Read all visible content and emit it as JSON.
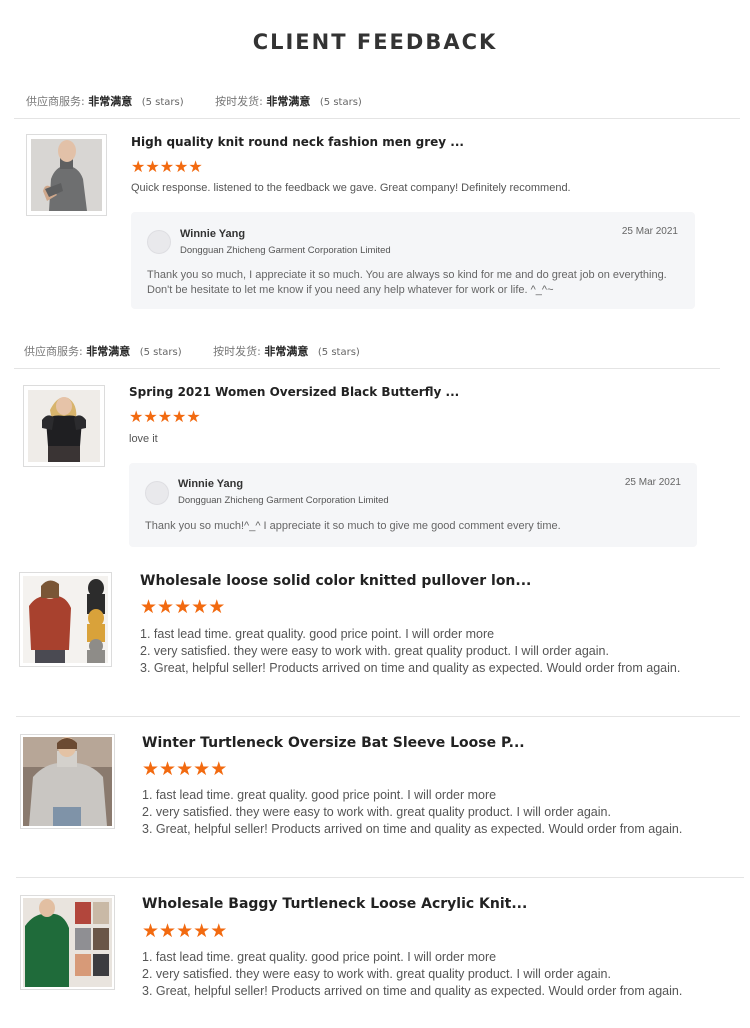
{
  "page": {
    "title": "CLIENT FEEDBACK"
  },
  "summary_rows": [
    {
      "service_label": "供应商服务:",
      "service_value": "非常满意",
      "service_stars": "(5 stars)",
      "delivery_label": "按时发货:",
      "delivery_value": "非常满意",
      "delivery_stars": "(5 stars)"
    },
    {
      "service_label": "供应商服务:",
      "service_value": "非常满意",
      "service_stars": "(5 stars)",
      "delivery_label": "按时发货:",
      "delivery_value": "非常满意",
      "delivery_stars": "(5 stars)"
    }
  ],
  "reviews": [
    {
      "title": "High quality knit round neck fashion men grey ...",
      "rating": 5,
      "text": "Quick response. listened to the feedback we gave. Great company! Definitely recommend.",
      "reply": {
        "name": "Winnie Yang",
        "company": "Dongguan Zhicheng Garment Corporation Limited",
        "date": "25 Mar 2021",
        "line1": "Thank you so much, I appreciate it so much. You are always so kind for me and do great job on everything.",
        "line2": "Don't be hesitate to let me know if you need any help whatever for work or life. ^_^~"
      }
    },
    {
      "title": "Spring 2021 Women Oversized Black Butterfly ...",
      "rating": 5,
      "text": "love it",
      "reply": {
        "name": "Winnie Yang",
        "company": "Dongguan Zhicheng Garment Corporation Limited",
        "date": "25 Mar 2021",
        "line1": "Thank you so much!^_^  I appreciate it so much to give me good comment every time."
      }
    },
    {
      "title": "Wholesale loose solid color knitted pullover lon...",
      "rating": 5,
      "lines": [
        "1. fast lead time. great quality. good price point. I will order more",
        "2. very satisfied. they were easy to work with. great quality product. I will order again.",
        "3. Great, helpful seller! Products arrived on time and quality as expected. Would order from again."
      ]
    },
    {
      "title": "Winter Turtleneck Oversize Bat Sleeve Loose P...",
      "rating": 5,
      "lines": [
        "1. fast lead time. great quality. good price point. I will order more",
        "2. very satisfied. they were easy to work with. great quality product. I will order again.",
        "3. Great, helpful seller! Products arrived on time and quality as expected. Would order from again."
      ]
    },
    {
      "title": "Wholesale Baggy Turtleneck Loose Acrylic Knit...",
      "rating": 5,
      "lines": [
        "1. fast lead time. great quality. good price point. I will order more",
        "2. very satisfied. they were easy to work with. great quality product. I will order again.",
        "3. Great, helpful seller! Products arrived on time and quality as expected. Would order from again."
      ]
    }
  ],
  "colors": {
    "star": "#f26a10",
    "reply_bg": "#f5f6f8",
    "divider": "#e4e4e4"
  },
  "icons": {
    "star": "star-icon",
    "avatar": "avatar-placeholder-icon"
  }
}
